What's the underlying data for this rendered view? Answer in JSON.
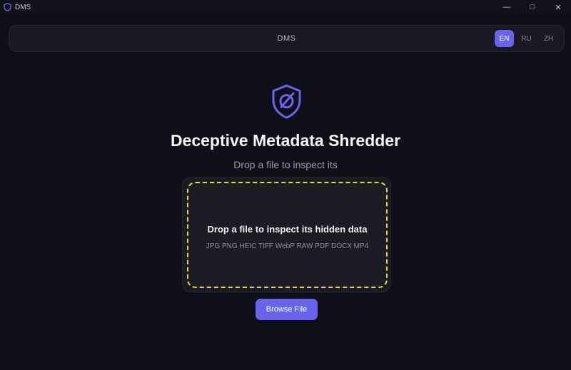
{
  "window": {
    "title": "DMS",
    "app_icon": "shield-icon",
    "controls": {
      "minimize": "—",
      "maximize": "□",
      "close": "✕"
    }
  },
  "navbar": {
    "brand": "DMS",
    "languages": [
      "EN",
      "RU",
      "ZH"
    ],
    "active_language": "EN"
  },
  "hero": {
    "icon": "shield-check-icon",
    "title": "Deceptive Metadata Shredder",
    "subtitle": "Drop a file to inspect its"
  },
  "dropzone": {
    "title": "Drop a file to inspect its hidden data",
    "formats": "JPG PNG HEIC TIFF WebP RAW PDF DOCX MP4"
  },
  "actions": {
    "browse_label": "Browse File"
  },
  "colors": {
    "accent": "#6a63ee",
    "dropzone_border": "#e6dd28",
    "background": "#0f0f18"
  }
}
